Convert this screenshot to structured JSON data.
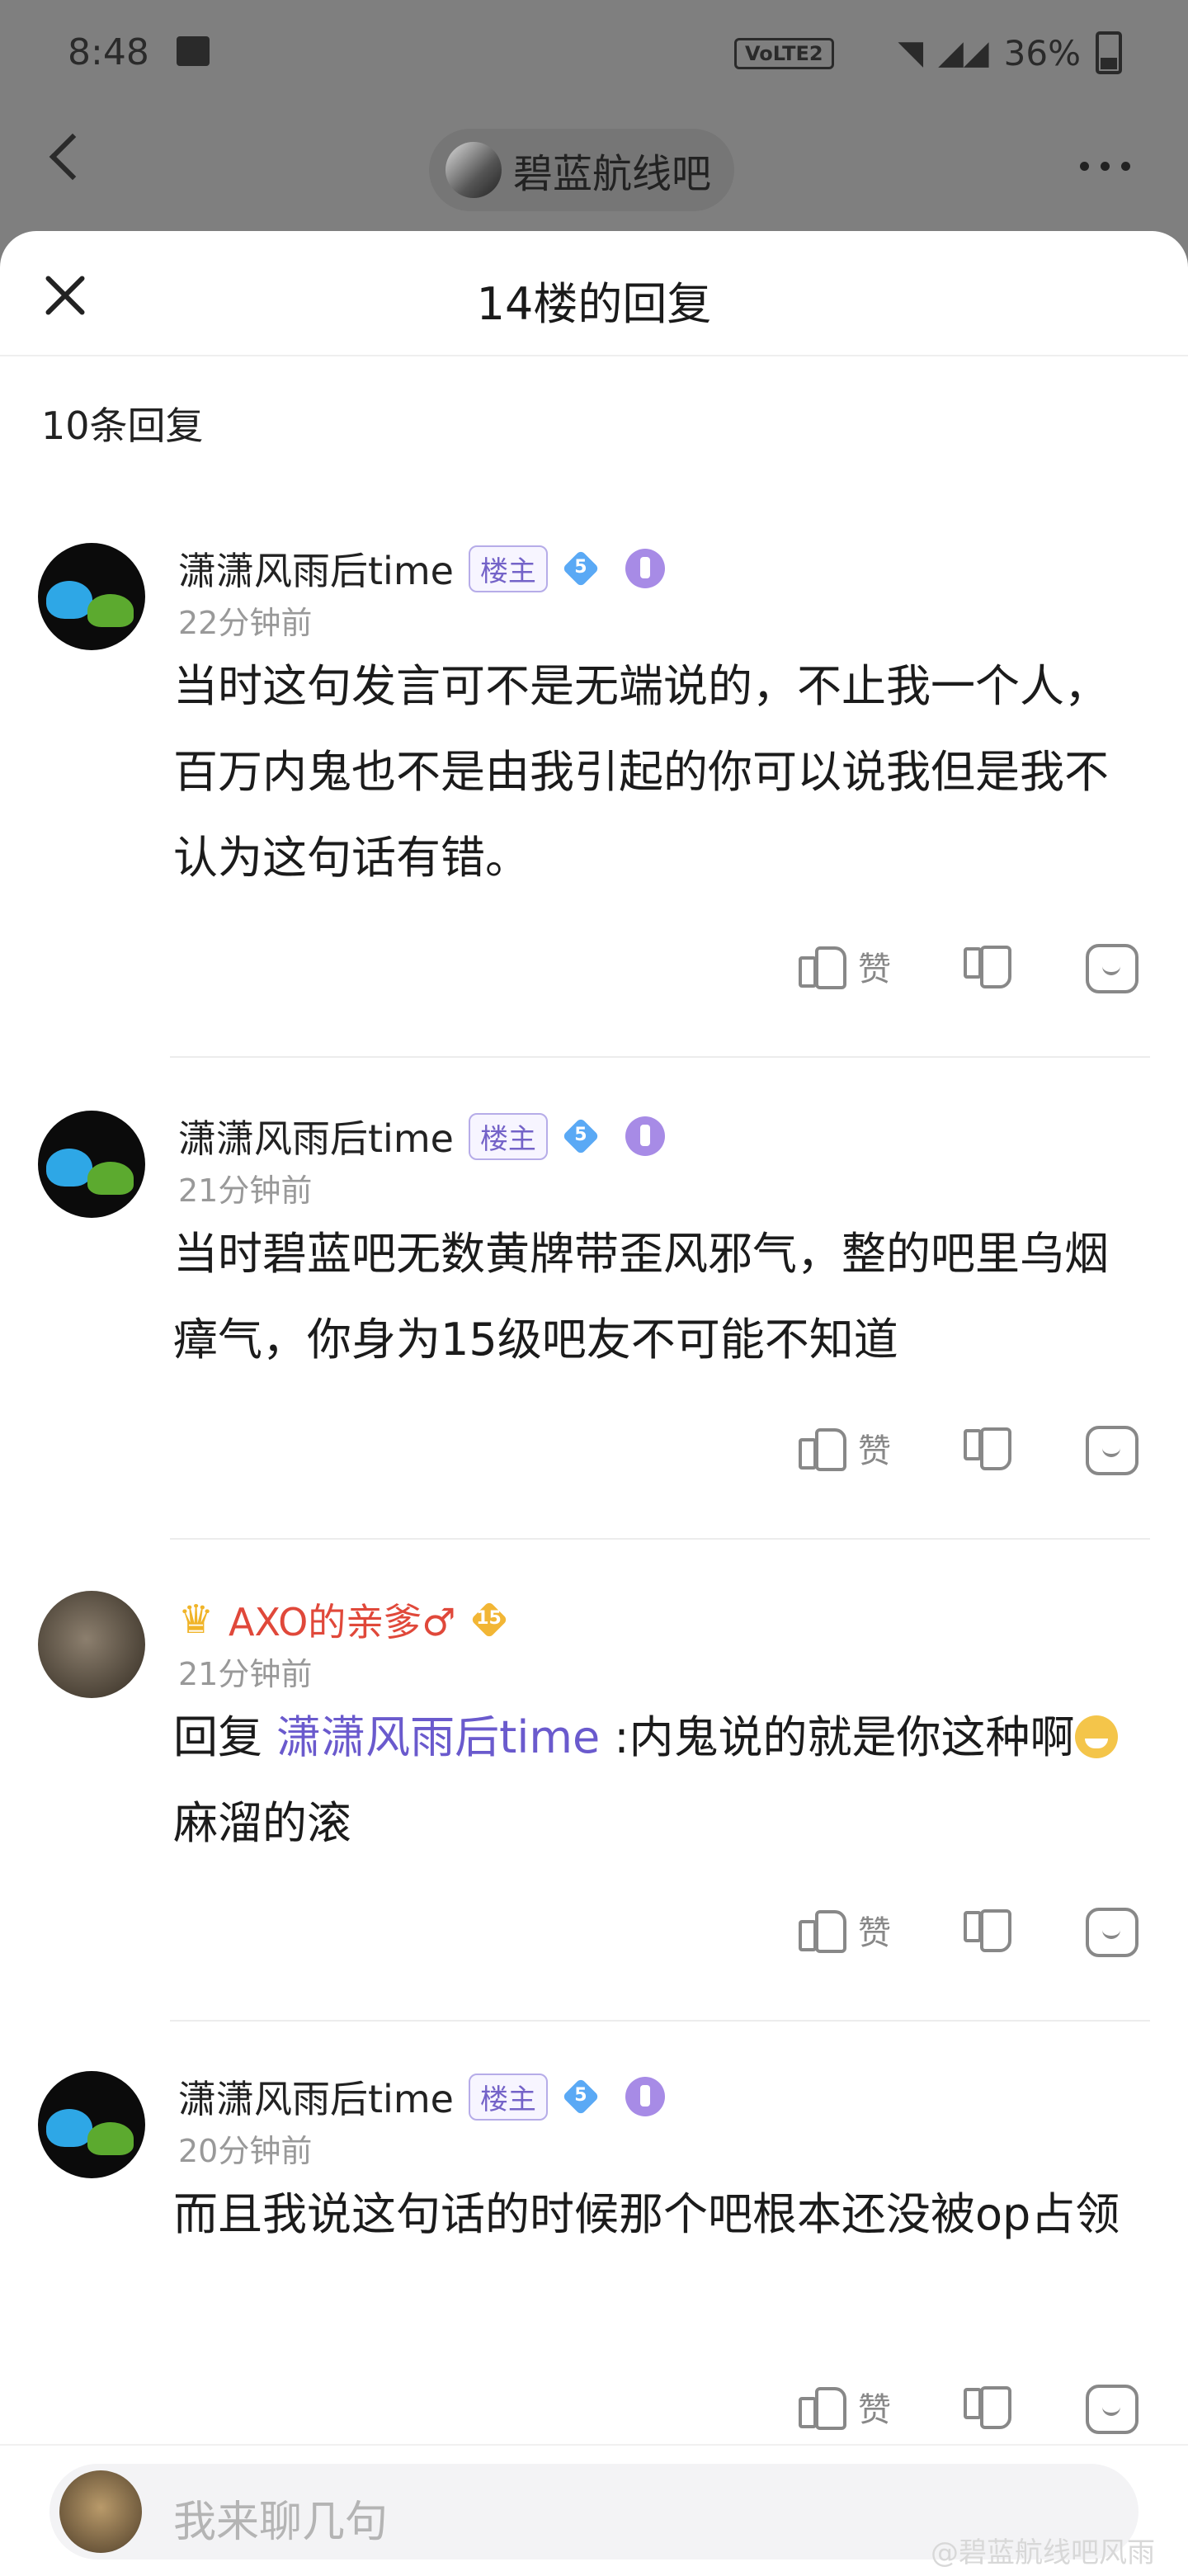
{
  "status_bar": {
    "time": "8:48",
    "network": "VoLTE2",
    "battery": "36%"
  },
  "background_header": {
    "forum_name": "碧蓝航线吧"
  },
  "sheet": {
    "title": "14楼的回复",
    "reply_count": "10条回复"
  },
  "replies": [
    {
      "username": "潇潇风雨后time",
      "tag": "楼主",
      "level": "5",
      "time": "22分钟前",
      "content": "当时这句发言可不是无端说的，不止我一个人，百万内鬼也不是由我引起的你可以说我但是我不认为这句话有错。",
      "like_label": "赞"
    },
    {
      "username": "潇潇风雨后time",
      "tag": "楼主",
      "level": "5",
      "time": "21分钟前",
      "content": "当时碧蓝吧无数黄牌带歪风邪气，整的吧里乌烟瘴气，你身为15级吧友不可能不知道",
      "like_label": "赞"
    },
    {
      "username": "AXO的亲爹♂",
      "level": "15",
      "time": "21分钟前",
      "content_prefix": "回复 ",
      "mention": "潇潇风雨后time",
      "content_after_mention": " :内鬼说的就是你这种啊",
      "content_end": "麻溜的滚",
      "like_label": "赞"
    },
    {
      "username": "潇潇风雨后time",
      "tag": "楼主",
      "level": "5",
      "time": "20分钟前",
      "content": "而且我说这句话的时候那个吧根本还没被op占领",
      "like_label": "赞"
    }
  ],
  "input": {
    "placeholder": "我来聊几句"
  },
  "watermark": "@碧蓝航线吧风雨"
}
